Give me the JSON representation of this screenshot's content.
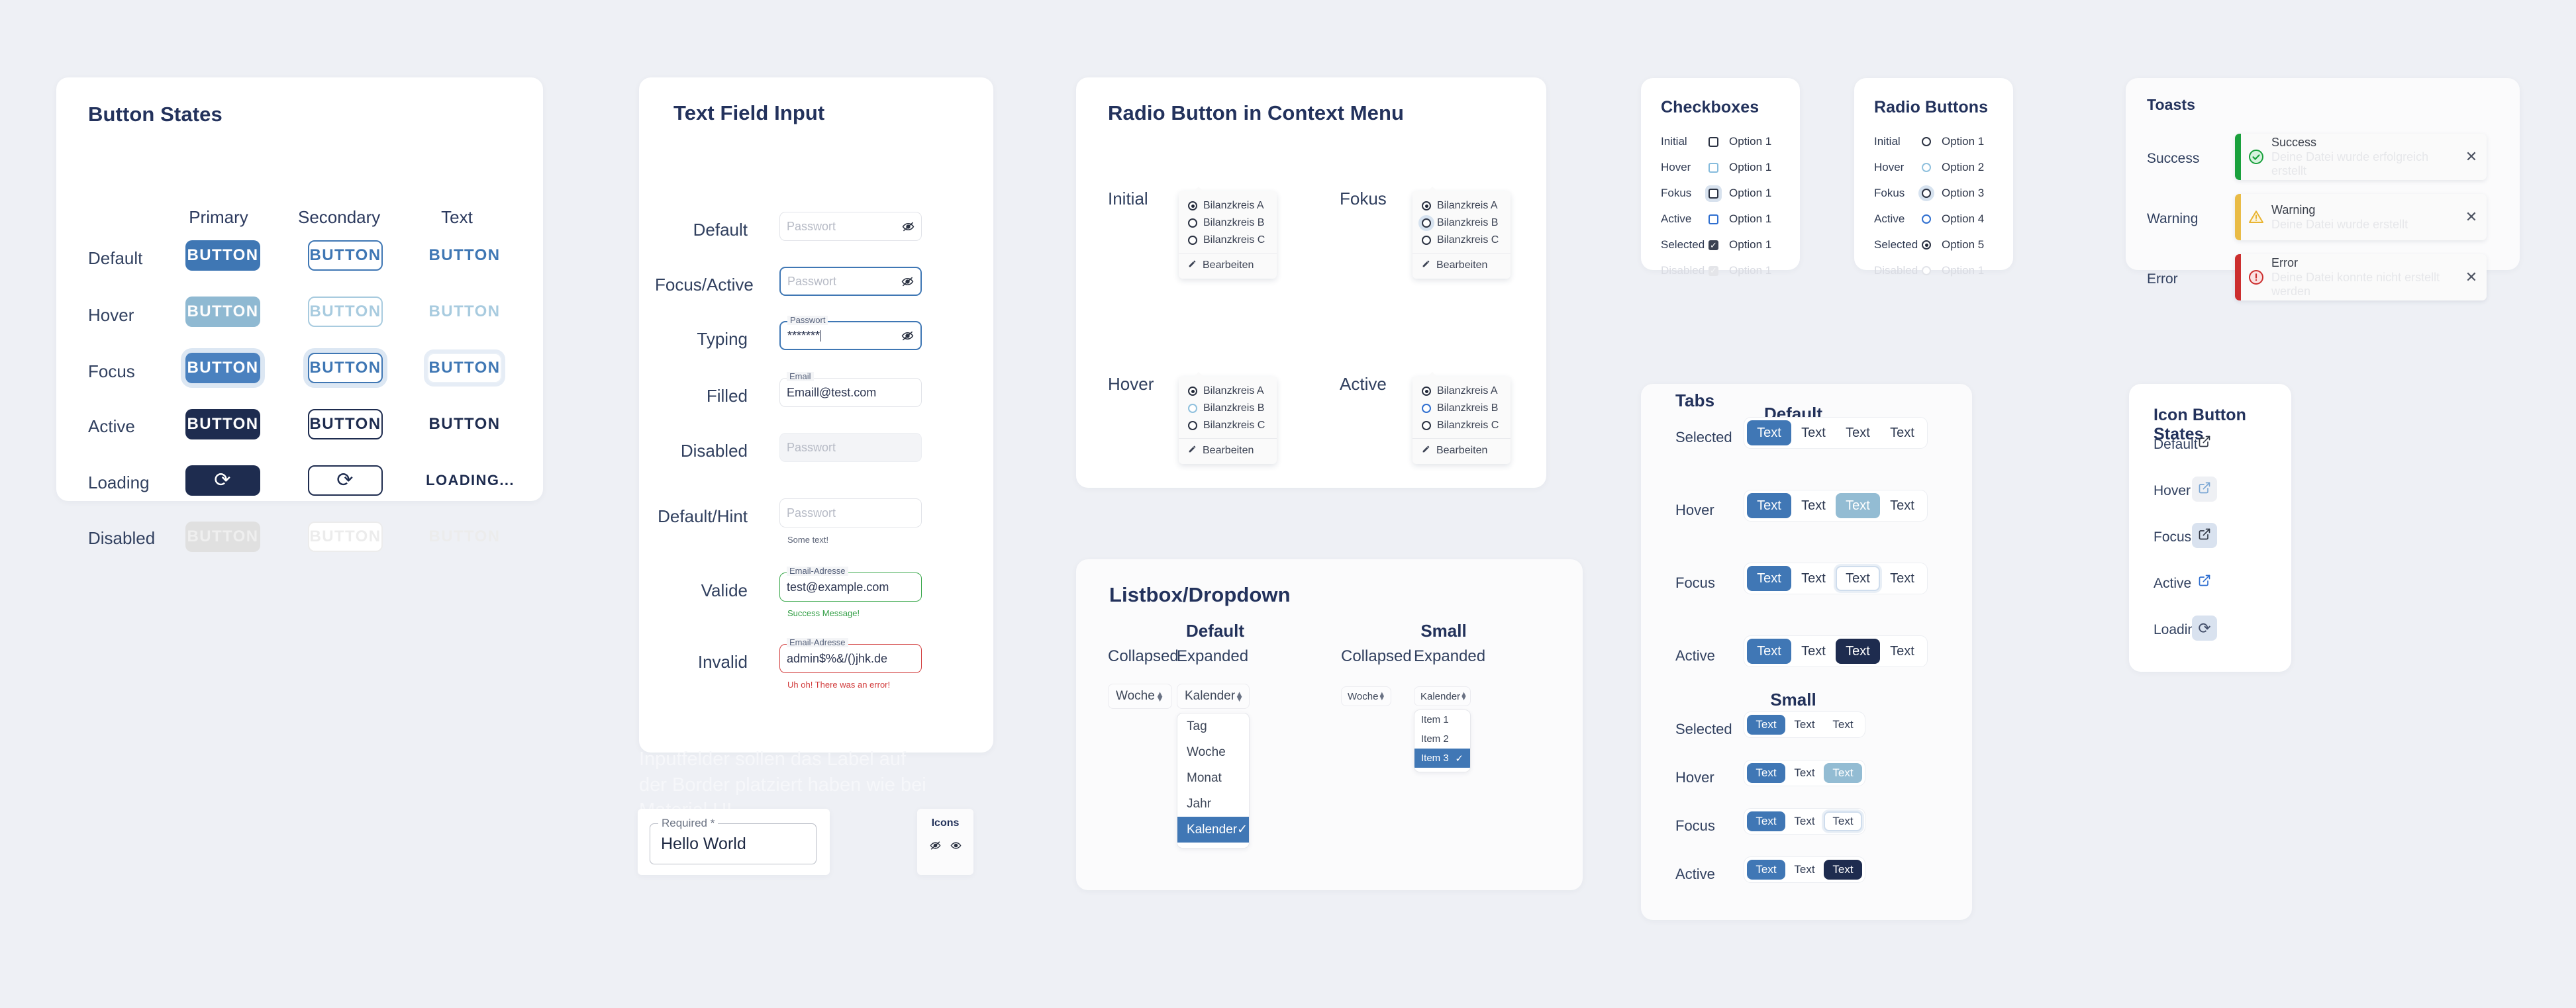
{
  "theme": {
    "page_background": "#eef0f5",
    "primary": "#3f77b4",
    "primary_hover": "#8fb9d2",
    "primary_active": "#1e2c4f",
    "success": "#2f9d42",
    "warning": "#e9b430",
    "error": "#d13b3b",
    "heading": "#23325c"
  },
  "button_states": {
    "title": "Button States",
    "columns": [
      "Primary",
      "Secondary",
      "Text"
    ],
    "rows": [
      "Default",
      "Hover",
      "Focus",
      "Active",
      "Loading",
      "Disabled"
    ],
    "label": "BUTTON",
    "loading_text_label": "LOADING...",
    "spinner_icon": "spinner-icon"
  },
  "text_field": {
    "title": "Text Field Input",
    "rows": [
      {
        "label": "Default",
        "notch": "",
        "placeholder": "Passwort",
        "value": "",
        "eye": "eye-off-icon",
        "helper": ""
      },
      {
        "label": "Focus/Active",
        "notch": "",
        "placeholder": "Passwort",
        "value": "",
        "eye": "eye-off-icon",
        "helper": ""
      },
      {
        "label": "Typing",
        "notch": "Passwort",
        "placeholder": "",
        "value": "*******",
        "eye": "eye-off-icon",
        "helper": ""
      },
      {
        "label": "Filled",
        "notch": "Email",
        "placeholder": "",
        "value": "Emaill@test.com",
        "eye": "",
        "helper": ""
      },
      {
        "label": "Disabled",
        "notch": "",
        "placeholder": "Passwort",
        "value": "",
        "eye": "",
        "helper": ""
      },
      {
        "label": "Default/Hint",
        "notch": "",
        "placeholder": "Passwort",
        "value": "",
        "eye": "",
        "helper": "Some text!"
      },
      {
        "label": "Valide",
        "notch": "Email-Adresse",
        "placeholder": "",
        "value": "test@example.com",
        "eye": "",
        "helper": "Success Message!"
      },
      {
        "label": "Invalid",
        "notch": "Email-Adresse",
        "placeholder": "",
        "value": "admin$%&/()jhk.de",
        "eye": "",
        "helper": "Uh oh! There was an error!"
      }
    ],
    "watermark": "Inputfelder sollen das Label auf der Border platziert haben wie bei Material UI",
    "required_field": {
      "notch": "Required *",
      "value": "Hello World"
    },
    "icons_card": {
      "title": "Icons",
      "icons": [
        "eye-off-icon",
        "eye-icon"
      ]
    }
  },
  "context_menu": {
    "title": "Radio Button in Context Menu",
    "states": [
      "Initial",
      "Fokus",
      "Hover",
      "Active"
    ],
    "options": [
      "Bilanzkreis A",
      "Bilanzkreis B",
      "Bilanzkreis C"
    ],
    "edit_label": "Bearbeiten",
    "edit_icon": "pencil-icon"
  },
  "listbox": {
    "title": "Listbox/Dropdown",
    "groups": [
      "Default",
      "Small"
    ],
    "states": [
      "Collapsed",
      "Expanded"
    ],
    "collapsed_value": "Woche",
    "expanded_value": "Kalender",
    "default_options": [
      "Tag",
      "Woche",
      "Monat",
      "Jahr",
      "Kalender"
    ],
    "default_selected": "Kalender",
    "small_options": [
      "Item 1",
      "Item 2",
      "Item 3"
    ],
    "small_selected": "Item 3",
    "check_icon": "check-icon",
    "chevron_icon": "chevron-updown-icon"
  },
  "checkboxes": {
    "title": "Checkboxes",
    "rows": [
      {
        "state": "Initial",
        "label": "Option 1"
      },
      {
        "state": "Hover",
        "label": "Option 1"
      },
      {
        "state": "Fokus",
        "label": "Option 1"
      },
      {
        "state": "Active",
        "label": "Option 1"
      },
      {
        "state": "Selected",
        "label": "Option 1"
      },
      {
        "state": "Disabled",
        "label": "Option 1"
      }
    ]
  },
  "radio_buttons": {
    "title": "Radio Buttons",
    "rows": [
      {
        "state": "Initial",
        "label": "Option 1"
      },
      {
        "state": "Hover",
        "label": "Option 2"
      },
      {
        "state": "Fokus",
        "label": "Option 3"
      },
      {
        "state": "Active",
        "label": "Option 4"
      },
      {
        "state": "Selected",
        "label": "Option 5"
      },
      {
        "state": "Disabled",
        "label": "Option 1"
      }
    ]
  },
  "toasts": {
    "title": "Toasts",
    "items": [
      {
        "state": "Success",
        "title": "Success",
        "message": "Deine Datei wurde erfolgreich erstellt",
        "icon": "check-circle-icon",
        "color": "#19a03c",
        "close": "close-icon"
      },
      {
        "state": "Warning",
        "title": "Warning",
        "message": "Deine Datei wurde erstellt",
        "icon": "warning-triangle-icon",
        "color": "#e9bb46",
        "close": "close-icon"
      },
      {
        "state": "Error",
        "title": "Error",
        "message": "Deine Datei konnte nicht erstellt werden",
        "icon": "error-circle-icon",
        "color": "#cc2e2e",
        "close": "close-icon"
      }
    ]
  },
  "tabs": {
    "title": "Tabs",
    "groups": [
      {
        "size_label": "Default",
        "rows": [
          "Selected",
          "Hover",
          "Focus",
          "Active"
        ],
        "count": 4
      },
      {
        "size_label": "Small",
        "rows": [
          "Selected",
          "Hover",
          "Focus",
          "Active"
        ],
        "count": 3
      }
    ],
    "tab_label": "Text"
  },
  "icon_buttons": {
    "title": "Icon Button States",
    "rows": [
      {
        "state": "Default",
        "icon": "external-link-icon"
      },
      {
        "state": "Hover",
        "icon": "external-link-icon"
      },
      {
        "state": "Focus",
        "icon": "external-link-icon"
      },
      {
        "state": "Active",
        "icon": "external-link-icon"
      },
      {
        "state": "Loading",
        "icon": "spinner-icon"
      }
    ]
  }
}
